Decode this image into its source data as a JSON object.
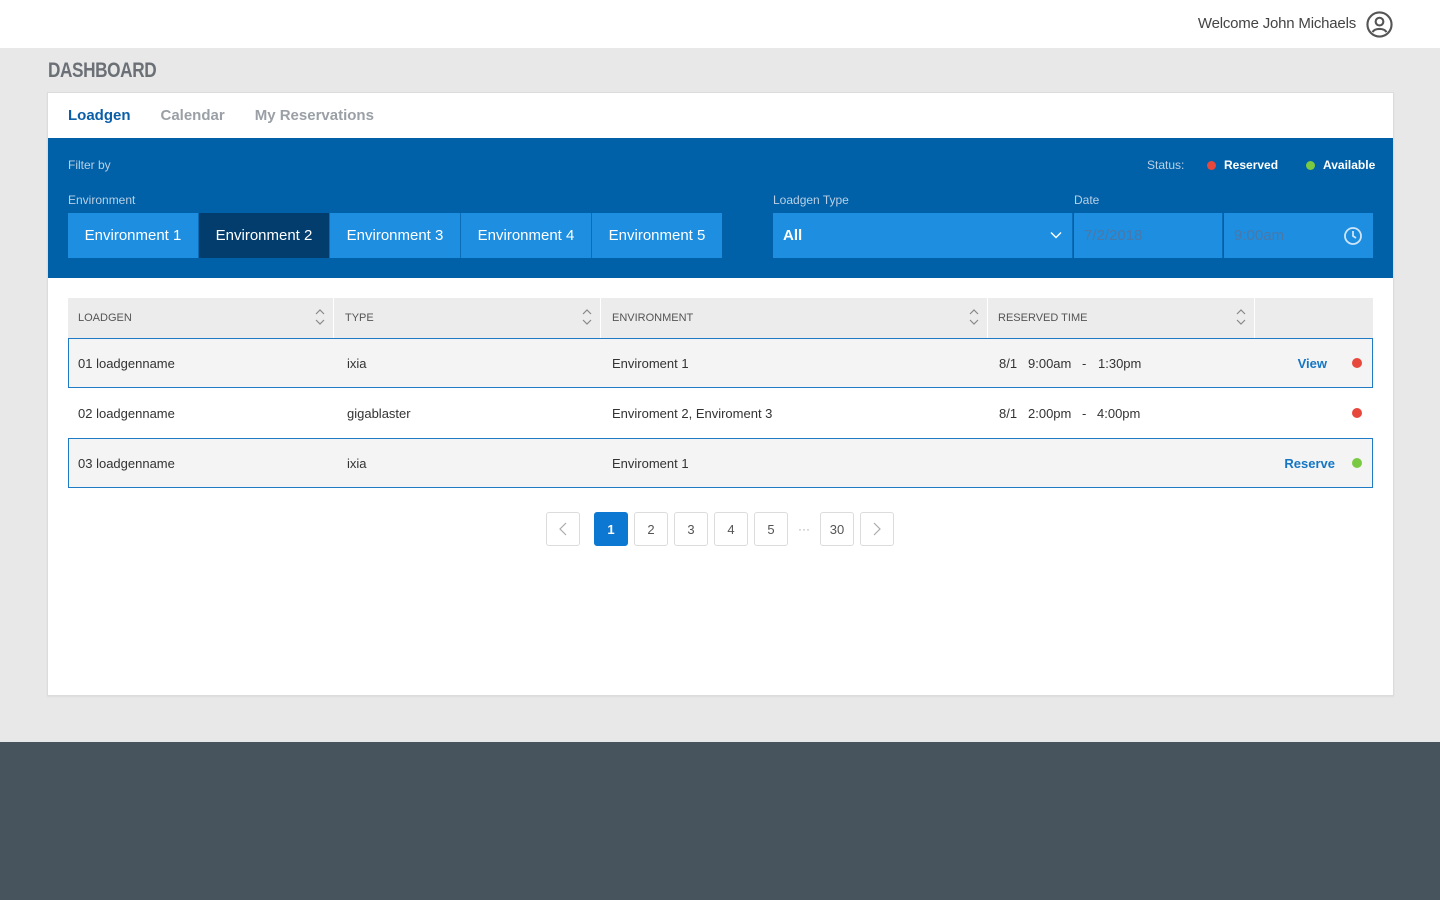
{
  "header": {
    "welcome": "Welcome John Michaels",
    "user_icon": "user-circle-icon"
  },
  "page_title": "DASHBOARD",
  "tabs": [
    {
      "label": "Loadgen",
      "active": true
    },
    {
      "label": "Calendar",
      "active": false
    },
    {
      "label": "My Reservations",
      "active": false
    }
  ],
  "filter": {
    "filter_by": "Filter by",
    "status_label": "Status:",
    "legend": {
      "reserved": {
        "label": "Reserved",
        "color": "#e8473c"
      },
      "available": {
        "label": "Available",
        "color": "#7ac943"
      }
    },
    "environment_label": "Environment",
    "environments": [
      {
        "label": "Environment 1",
        "active": false
      },
      {
        "label": "Environment 2",
        "active": true
      },
      {
        "label": "Environment 3",
        "active": false
      },
      {
        "label": "Environment 4",
        "active": false
      },
      {
        "label": "Environment 5",
        "active": false
      }
    ],
    "loadgen_type_label": "Loadgen Type",
    "loadgen_type_value": "All",
    "date_label": "Date",
    "date_value": "7/2/2018",
    "time_value": "9:00am"
  },
  "table": {
    "columns": [
      "LOADGEN",
      "TYPE",
      "ENVIRONMENT",
      "RESERVED TIME"
    ],
    "rows": [
      {
        "loadgen": "01 loadgenname",
        "type": "ixia",
        "environment": "Enviroment 1",
        "date": "8/1",
        "start": "9:00am",
        "sep": "-",
        "end": "1:30pm",
        "action": "View",
        "status": "reserved"
      },
      {
        "loadgen": "02 loadgenname",
        "type": "gigablaster",
        "environment": "Enviroment 2, Enviroment 3",
        "date": "8/1",
        "start": "2:00pm",
        "sep": "-",
        "end": "4:00pm",
        "action": "",
        "status": "reserved"
      },
      {
        "loadgen": "03 loadgenname",
        "type": "ixia",
        "environment": "Enviroment 1",
        "date": "",
        "start": "",
        "sep": "",
        "end": "",
        "action": "Reserve",
        "status": "available"
      }
    ]
  },
  "pagination": {
    "current": "1",
    "pages": [
      "2",
      "3",
      "4",
      "5"
    ],
    "ellipsis": "···",
    "last": "30"
  },
  "colors": {
    "primary": "#0061a8",
    "button": "#1e8ee0",
    "button_active": "#023d6d",
    "footer": "#48545d"
  }
}
